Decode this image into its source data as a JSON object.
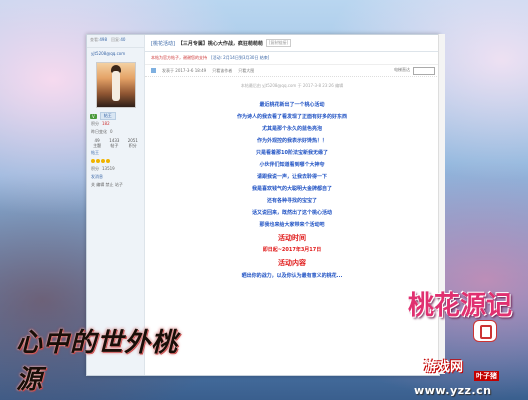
{
  "site": "www.yzz.cn",
  "game_logo": "游戏网",
  "game_logo_sub": "叶子猪",
  "left_logo": "心中的世外桃源",
  "right_logo": "桃花源记",
  "sidebar": {
    "top": [
      {
        "label": "查看:",
        "value": "498"
      },
      {
        "label": "回复:",
        "value": "40"
      }
    ],
    "user_tag": "楼主",
    "username": "yjt5208@qq.com",
    "vip": "V",
    "level": "帖王",
    "fields": [
      {
        "label": "积分",
        "value": "182"
      },
      {
        "label": "昨日变化",
        "value": "0"
      }
    ],
    "stats": [
      {
        "value": "49",
        "label": "主题"
      },
      {
        "value": "1433",
        "label": "帖子"
      },
      {
        "value": "2051",
        "label": "积分"
      }
    ],
    "rank": "帖王",
    "money_label": "积分",
    "money_value": "13519",
    "medal": "发消息",
    "actions": "关 编辑 禁止 站子"
  },
  "thread": {
    "category": "[桃花活动]",
    "title": "【三月专属】桃心大作战，疯狂萌萌萌",
    "code": "[复制链接]",
    "notice_left": "本帖为官方帖子，谢谢您的支持",
    "notice_right": "[活动: 2月14日到3月30日 结束]",
    "meta_date": "发表于 2017-3-6 18:49",
    "meta_only": "只看该作者",
    "meta_big": "只看大图",
    "meta_right": "电梯直达",
    "sig": "本帖最后由 yjt5208@qq.com 于 2017-3-8 23:26 编辑"
  },
  "post_lines": [
    {
      "text": "最近桃花新出了一个桃心活动",
      "style": "blue"
    },
    {
      "text": "作为诗人的我去看了看发现了正面有好多的好东西",
      "style": "blue"
    },
    {
      "text": "尤其是那个永久的蓝色亮泡",
      "style": "blue"
    },
    {
      "text": "作为外观控的我表示好馋热！！",
      "style": "blue"
    },
    {
      "text": "只是看着那10阶法宝新我无缘了",
      "style": "blue"
    },
    {
      "text": "小伙伴们知道看到哪个大神夸",
      "style": "blue"
    },
    {
      "text": "请跟我说一声，让我去聆得一下",
      "style": "blue"
    },
    {
      "text": "我是喜欢钱气的大聪明大金牌都自了",
      "style": "blue"
    },
    {
      "text": "还有各种寻找的宝宝了",
      "style": "blue"
    },
    {
      "text": "话又说回来，既然出了这个桃心活动",
      "style": "blue"
    },
    {
      "text": "那我也来给大家带来个活动吧",
      "style": "blue"
    },
    {
      "text": "活动时间",
      "style": "red"
    },
    {
      "text": "即日起~2017年3月17日",
      "style": "red-small"
    },
    {
      "text": "活动内容",
      "style": "red"
    },
    {
      "text": "晒出你的战力，以及你认为最有意义的桃花...",
      "style": "blue"
    }
  ]
}
